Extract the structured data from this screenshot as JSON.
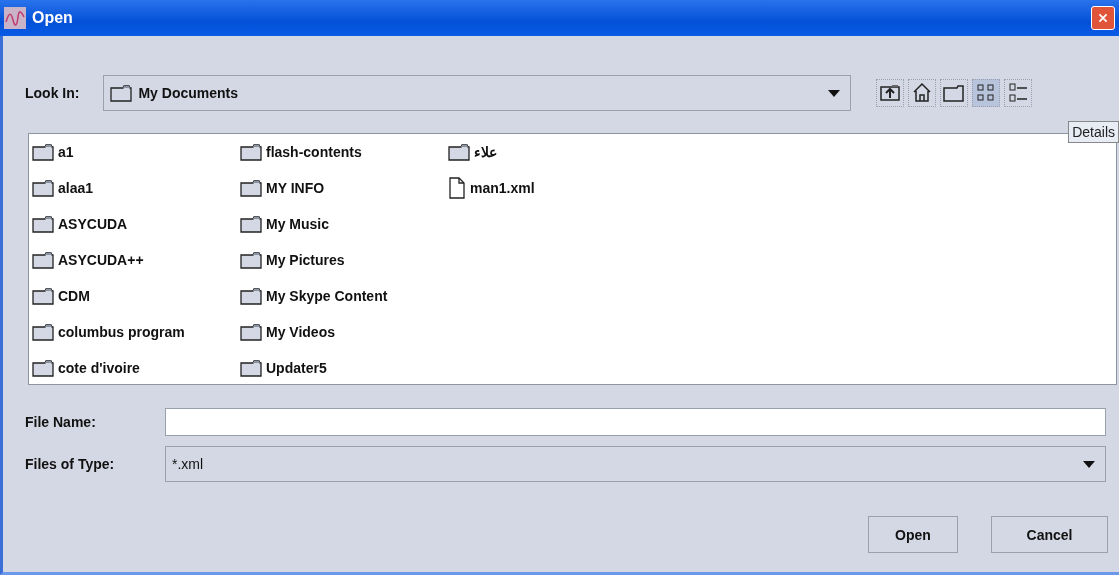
{
  "window": {
    "title": "Open"
  },
  "look_in": {
    "label": "Look In:",
    "value": "My Documents"
  },
  "toolbar": [
    {
      "kind": "up",
      "selected": false
    },
    {
      "kind": "home",
      "selected": false
    },
    {
      "kind": "new-folder",
      "selected": false
    },
    {
      "kind": "list",
      "selected": true
    },
    {
      "kind": "details",
      "selected": false
    }
  ],
  "tooltip": "Details",
  "files": [
    {
      "name": "a1",
      "kind": "folder"
    },
    {
      "name": "alaa1",
      "kind": "folder"
    },
    {
      "name": "ASYCUDA",
      "kind": "folder"
    },
    {
      "name": "ASYCUDA++",
      "kind": "folder"
    },
    {
      "name": "CDM",
      "kind": "folder"
    },
    {
      "name": "columbus program",
      "kind": "folder"
    },
    {
      "name": "cote d'ivoire",
      "kind": "folder"
    },
    {
      "name": "flash-contents",
      "kind": "folder"
    },
    {
      "name": "MY INFO",
      "kind": "folder"
    },
    {
      "name": "My Music",
      "kind": "folder"
    },
    {
      "name": "My Pictures",
      "kind": "folder"
    },
    {
      "name": "My Skype Content",
      "kind": "folder"
    },
    {
      "name": "My Videos",
      "kind": "folder"
    },
    {
      "name": "Updater5",
      "kind": "folder"
    },
    {
      "name": "علاء",
      "kind": "folder"
    },
    {
      "name": "man1.xml",
      "kind": "file"
    }
  ],
  "file_name": {
    "label": "File Name:"
  },
  "file_type": {
    "label": "Files of Type:",
    "value": "*.xml"
  },
  "buttons": [
    "Open",
    "Cancel"
  ]
}
